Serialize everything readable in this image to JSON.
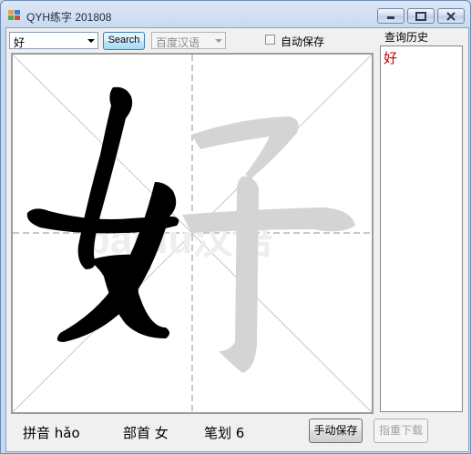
{
  "window": {
    "title": "QYH练字 201808"
  },
  "toolbar": {
    "char_value": "好",
    "search_label": "Search",
    "source_value": "百度汉语",
    "autosave_label": "自动保存",
    "autosave_checked": false
  },
  "canvas": {
    "character": "好",
    "watermark": "baidu汉语"
  },
  "history": {
    "title": "查询历史",
    "items": [
      "好"
    ]
  },
  "info": {
    "pinyin": "拼音 hǎo",
    "radical": "部首 女",
    "strokes": "笔划 6"
  },
  "buttons": {
    "manual_save": "手动保存",
    "download": "指重下载"
  },
  "colors": {
    "history_item": "#c00000",
    "glyph_black": "#000000",
    "glyph_gray": "#d4d4d4"
  }
}
